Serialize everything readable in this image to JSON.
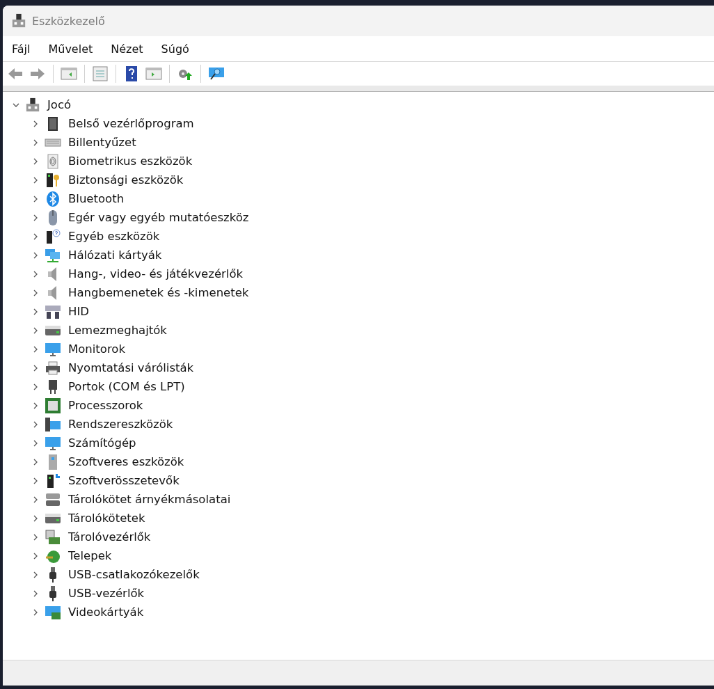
{
  "window": {
    "title": "Eszközkezelő"
  },
  "menu": [
    {
      "label": "Fájl"
    },
    {
      "label": "Művelet"
    },
    {
      "label": "Nézet"
    },
    {
      "label": "Súgó"
    }
  ],
  "tree": {
    "label": "Jocó",
    "expanded": true,
    "children": [
      {
        "label": "Belső vezérlőprogram",
        "kind": "chip",
        "expanded": false
      },
      {
        "label": "Billentyűzet",
        "kind": "keyboard",
        "expanded": false
      },
      {
        "label": "Biometrikus eszközök",
        "kind": "fingerprint",
        "expanded": false
      },
      {
        "label": "Biztonsági eszközök",
        "kind": "key",
        "expanded": false
      },
      {
        "label": "Bluetooth",
        "kind": "bluetooth",
        "expanded": false
      },
      {
        "label": "Egér vagy egyéb mutatóeszköz",
        "kind": "mouse",
        "expanded": false
      },
      {
        "label": "Egyéb eszközök",
        "kind": "unknown",
        "expanded": false
      },
      {
        "label": "Hálózati kártyák",
        "kind": "network",
        "expanded": false
      },
      {
        "label": "Hang-, video- és játékvezérlők",
        "kind": "speaker",
        "expanded": false
      },
      {
        "label": "Hangbemenetek és -kimenetek",
        "kind": "speaker",
        "expanded": false
      },
      {
        "label": "HID",
        "kind": "hid",
        "expanded": false
      },
      {
        "label": "Lemezmeghajtók",
        "kind": "drive",
        "expanded": false
      },
      {
        "label": "Monitorok",
        "kind": "monitor",
        "expanded": false
      },
      {
        "label": "Nyomtatási várólisták",
        "kind": "printer",
        "expanded": false
      },
      {
        "label": "Portok (COM és LPT)",
        "kind": "port",
        "expanded": false
      },
      {
        "label": "Processzorok",
        "kind": "cpu",
        "expanded": false
      },
      {
        "label": "Rendszereszközök",
        "kind": "system",
        "expanded": false
      },
      {
        "label": "Számítógép",
        "kind": "monitor",
        "expanded": false
      },
      {
        "label": "Szoftveres eszközök",
        "kind": "tower",
        "expanded": false
      },
      {
        "label": "Szoftverösszetevők",
        "kind": "component",
        "expanded": false
      },
      {
        "label": "Tárolókötet árnyékmásolatai",
        "kind": "drives",
        "expanded": false
      },
      {
        "label": "Tárolókötetek",
        "kind": "drive",
        "expanded": false
      },
      {
        "label": "Tárolóvezérlők",
        "kind": "controller",
        "expanded": false
      },
      {
        "label": "Telepek",
        "kind": "battery",
        "expanded": false
      },
      {
        "label": "USB-csatlakozókezelők",
        "kind": "usb",
        "expanded": false
      },
      {
        "label": "USB-vezérlők",
        "kind": "usb",
        "expanded": false
      },
      {
        "label": "Videokártyák",
        "kind": "videocard",
        "expanded": false
      }
    ]
  }
}
